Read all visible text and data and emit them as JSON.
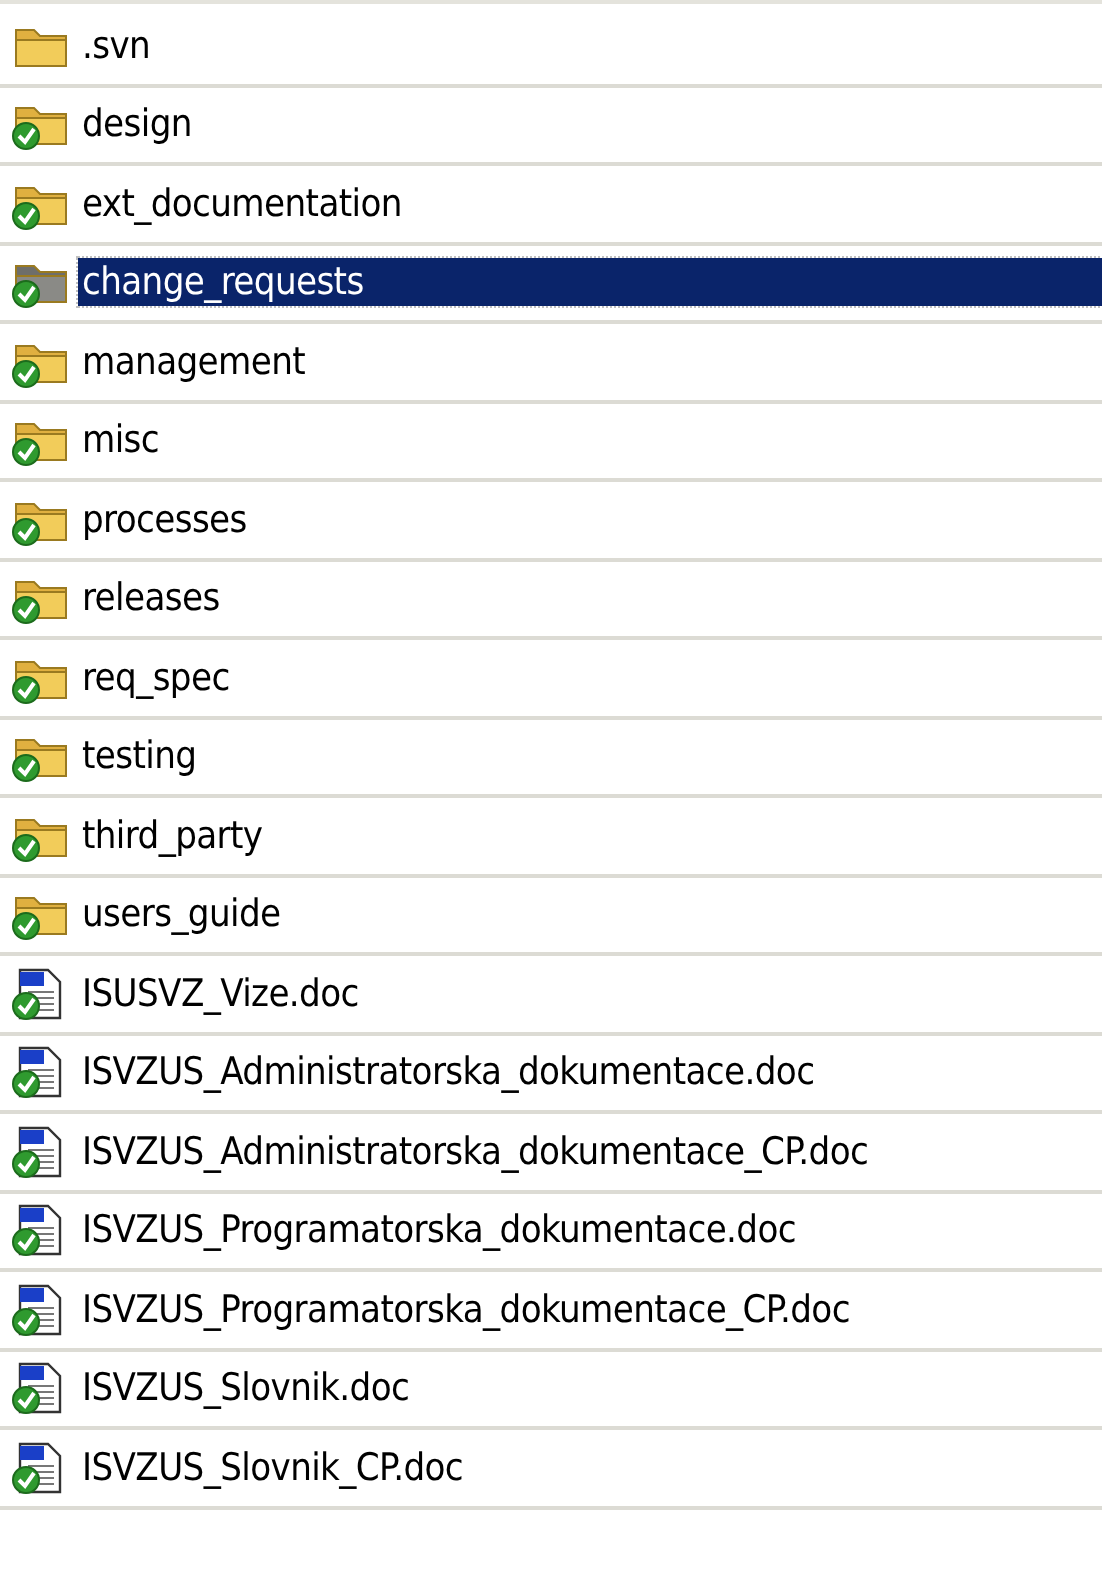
{
  "files": [
    {
      "name": ".svn",
      "kind": "folder",
      "versioned": false,
      "selected": false
    },
    {
      "name": "design",
      "kind": "folder",
      "versioned": true,
      "selected": false
    },
    {
      "name": "ext_documentation",
      "kind": "folder",
      "versioned": true,
      "selected": false
    },
    {
      "name": "change_requests",
      "kind": "folder",
      "versioned": true,
      "selected": true
    },
    {
      "name": "management",
      "kind": "folder",
      "versioned": true,
      "selected": false
    },
    {
      "name": "misc",
      "kind": "folder",
      "versioned": true,
      "selected": false
    },
    {
      "name": "processes",
      "kind": "folder",
      "versioned": true,
      "selected": false
    },
    {
      "name": "releases",
      "kind": "folder",
      "versioned": true,
      "selected": false
    },
    {
      "name": "req_spec",
      "kind": "folder",
      "versioned": true,
      "selected": false
    },
    {
      "name": "testing",
      "kind": "folder",
      "versioned": true,
      "selected": false
    },
    {
      "name": "third_party",
      "kind": "folder",
      "versioned": true,
      "selected": false
    },
    {
      "name": "users_guide",
      "kind": "folder",
      "versioned": true,
      "selected": false
    },
    {
      "name": "ISUSVZ_Vize.doc",
      "kind": "document",
      "versioned": true,
      "selected": false
    },
    {
      "name": "ISVZUS_Administratorska_dokumentace.doc",
      "kind": "document",
      "versioned": true,
      "selected": false
    },
    {
      "name": "ISVZUS_Administratorska_dokumentace_CP.doc",
      "kind": "document",
      "versioned": true,
      "selected": false
    },
    {
      "name": "ISVZUS_Programatorska_dokumentace.doc",
      "kind": "document",
      "versioned": true,
      "selected": false
    },
    {
      "name": "ISVZUS_Programatorska_dokumentace_CP.doc",
      "kind": "document",
      "versioned": true,
      "selected": false
    },
    {
      "name": "ISVZUS_Slovnik.doc",
      "kind": "document",
      "versioned": true,
      "selected": false
    },
    {
      "name": "ISVZUS_Slovnik_CP.doc",
      "kind": "document",
      "versioned": true,
      "selected": false
    }
  ]
}
